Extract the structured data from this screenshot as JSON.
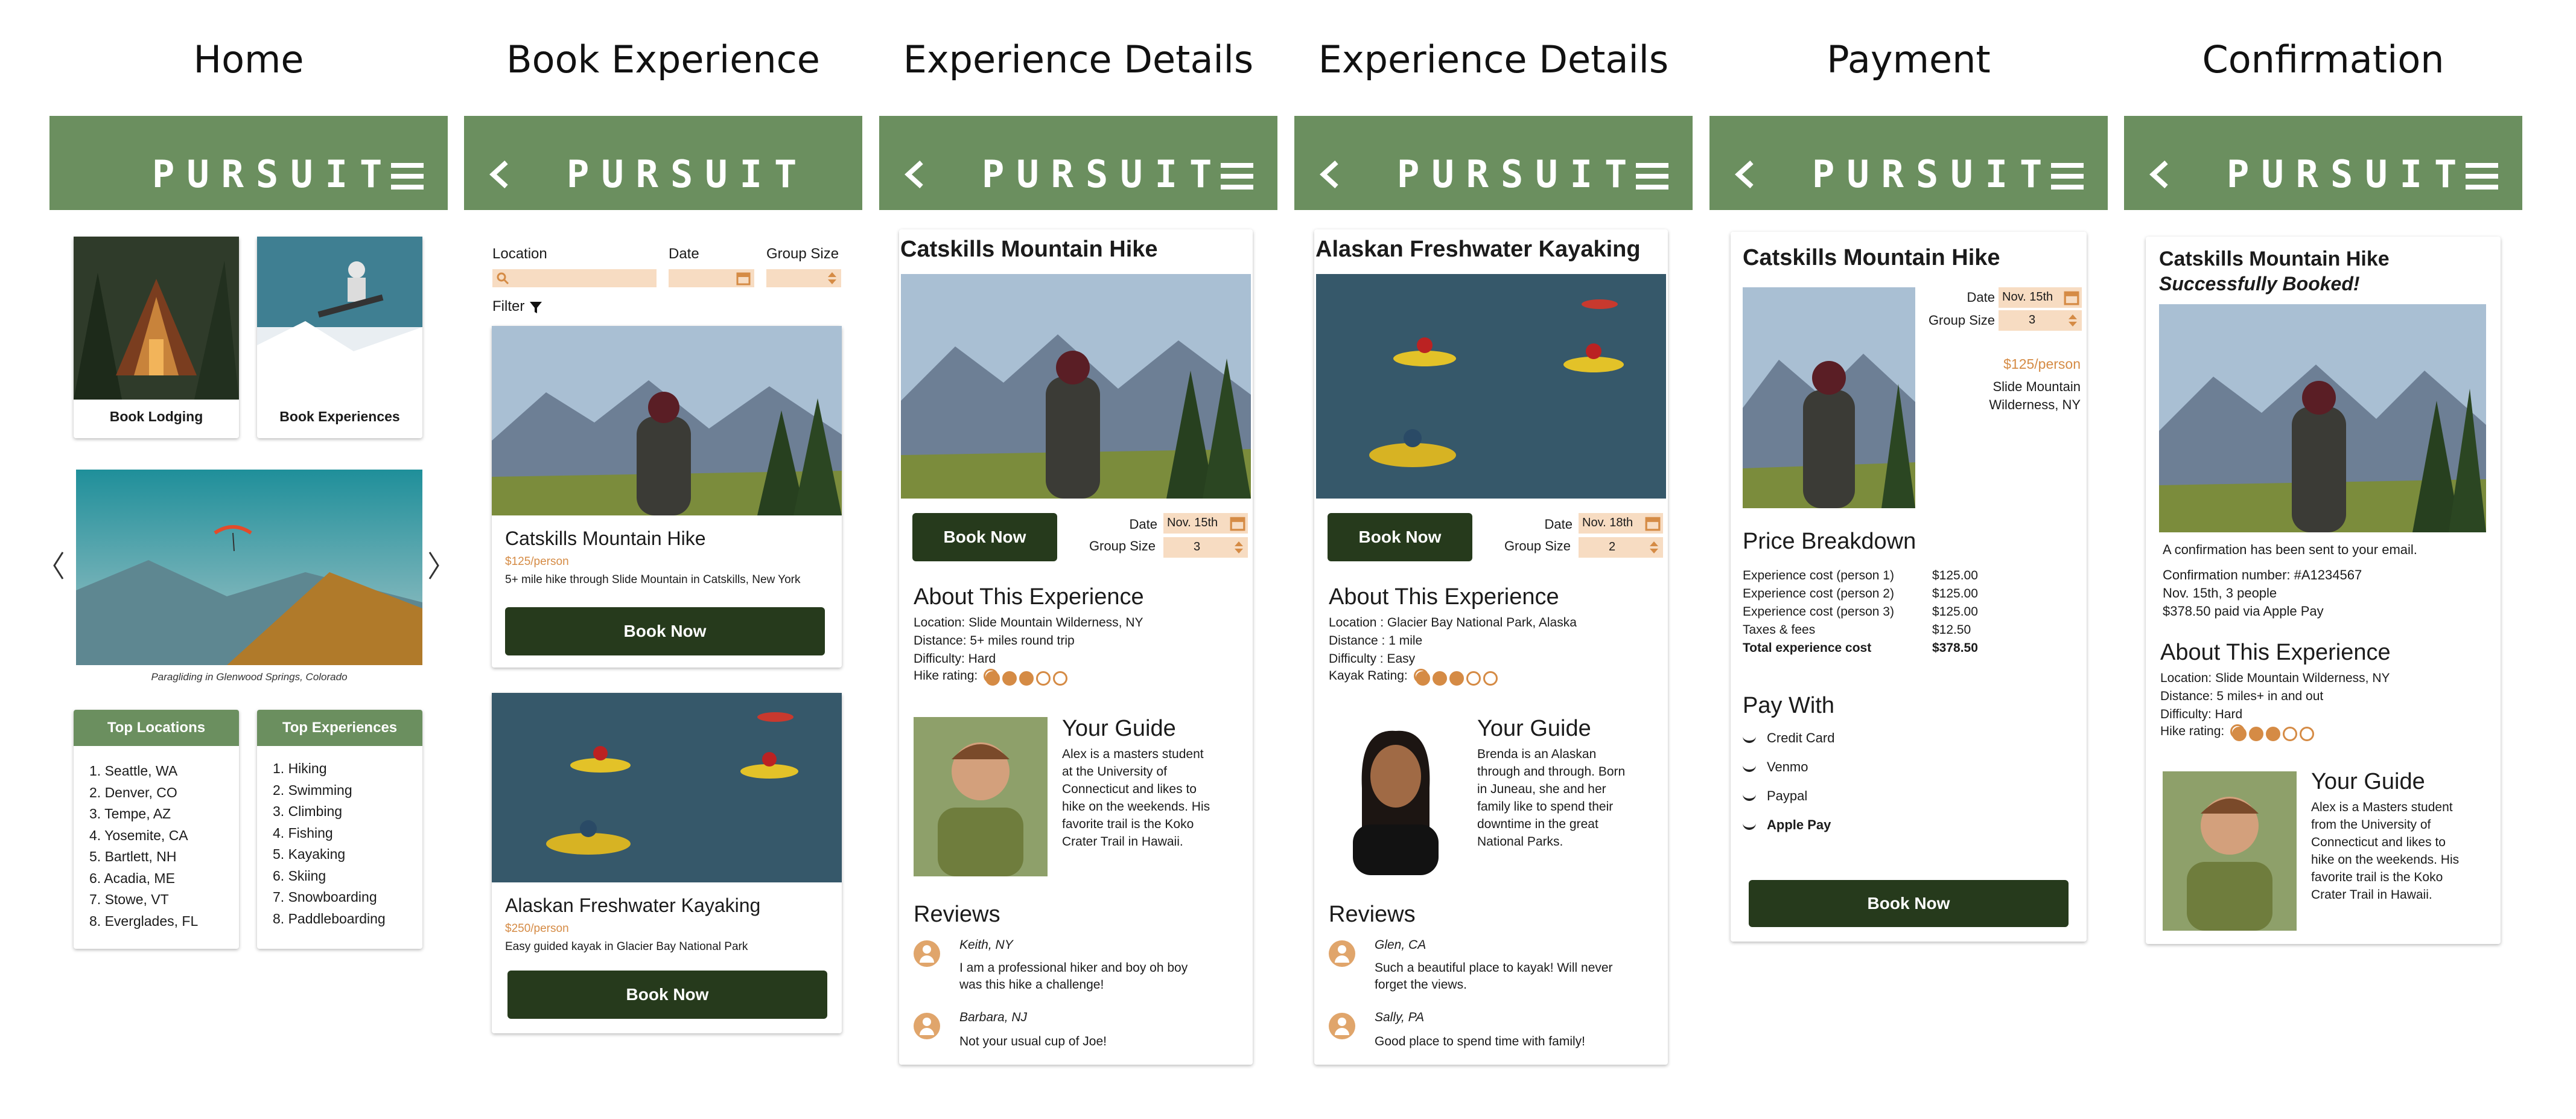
{
  "titles": [
    "Home",
    "Book Experience",
    "Experience Details",
    "Experience Details",
    "Payment",
    "Confirmation"
  ],
  "brand": "PURSUIT",
  "home": {
    "book_lodging": "Book Lodging",
    "book_experiences": "Book Experiences",
    "caption": "Paragliding in Glenwood Springs, Colorado",
    "top_locations_title": "Top Locations",
    "top_locations": [
      "1. Seattle, WA",
      "2. Denver, CO",
      "3. Tempe, AZ",
      "4. Yosemite, CA",
      "5. Bartlett, NH",
      "6. Acadia, ME",
      "7. Stowe, VT",
      "8. Everglades, FL"
    ],
    "top_experiences_title": "Top Experiences",
    "top_experiences": [
      "1. Hiking",
      "2. Swimming",
      "3. Climbing",
      "4. Fishing",
      "5. Kayaking",
      "6. Skiing",
      "7. Snowboarding",
      "8. Paddleboarding"
    ]
  },
  "book": {
    "location_label": "Location",
    "date_label": "Date",
    "group_label": "Group Size",
    "filter_label": "Filter",
    "items": [
      {
        "title": "Catskills Mountain Hike",
        "price": "$125/person",
        "desc": "5+ mile hike through Slide Mountain in Catskills, New York",
        "cta": "Book Now"
      },
      {
        "title": "Alaskan Freshwater Kayaking",
        "price": "$250/person",
        "desc": "Easy guided kayak in Glacier Bay National Park",
        "cta": "Book Now"
      }
    ]
  },
  "details1": {
    "title": "Catskills Mountain Hike",
    "cta": "Book Now",
    "date_label": "Date",
    "date_value": "Nov. 15th",
    "group_label": "Group Size",
    "group_value": "3",
    "about_title": "About This Experience",
    "about_lines": [
      "Location: Slide Mountain Wilderness, NY",
      "Distance: 5+ miles round trip",
      "Difficulty: Hard"
    ],
    "rating_label": "Hike rating:",
    "rating": 3,
    "guide_title": "Your Guide",
    "guide_text": [
      "Alex is a masters student",
      "at the University of",
      "Connecticut and likes to",
      "hike on the weekends. His",
      "favorite trail is the Koko",
      "Crater Trail in Hawaii."
    ],
    "reviews_title": "Reviews",
    "reviews": [
      {
        "name": "Keith, NY",
        "text": [
          "I am a professional hiker and boy oh boy",
          "was this hike a challenge!"
        ]
      },
      {
        "name": "Barbara, NJ",
        "text": [
          "Not your usual cup of Joe!"
        ]
      }
    ]
  },
  "details2": {
    "title": "Alaskan Freshwater Kayaking",
    "cta": "Book Now",
    "date_label": "Date",
    "date_value": "Nov. 18th",
    "group_label": "Group Size",
    "group_value": "2",
    "about_title": "About This Experience",
    "about_lines": [
      "Location : Glacier Bay National Park, Alaska",
      "Distance : 1 mile",
      "Difficulty : Easy"
    ],
    "rating_label": "Kayak Rating:",
    "rating": 3,
    "guide_title": "Your Guide",
    "guide_text": [
      "Brenda is an Alaskan",
      "through and through. Born",
      "in Juneau, she and her",
      "family like to spend their",
      "downtime in the great",
      "National Parks."
    ],
    "reviews_title": "Reviews",
    "reviews": [
      {
        "name": "Glen, CA",
        "text": [
          "Such a beautiful place to kayak! Will never",
          "forget the views."
        ]
      },
      {
        "name": "Sally, PA",
        "text": [
          "Good place to spend time with family!"
        ]
      }
    ]
  },
  "payment": {
    "title": "Catskills Mountain Hike",
    "date_label": "Date",
    "date_value": "Nov. 15th",
    "group_label": "Group Size",
    "group_value": "3",
    "price": "$125/person",
    "location": [
      "Slide Mountain",
      "Wilderness, NY"
    ],
    "breakdown_title": "Price Breakdown",
    "breakdown": [
      {
        "label": "Experience cost (person 1)",
        "value": "$125.00"
      },
      {
        "label": "Experience cost (person 2)",
        "value": "$125.00"
      },
      {
        "label": "Experience cost (person 3)",
        "value": "$125.00"
      },
      {
        "label": "Taxes & fees",
        "value": "$12.50"
      },
      {
        "label": "Total experience cost",
        "value": "$378.50"
      }
    ],
    "pay_title": "Pay With",
    "methods": [
      "Credit Card",
      "Venmo",
      "Paypal",
      "Apple Pay"
    ],
    "cta": "Book Now"
  },
  "confirm": {
    "title": "Catskills Mountain Hike",
    "subtitle": "Successfully Booked!",
    "lines": [
      "A confirmation has been sent to your email.",
      "Confirmation number: #A1234567",
      "Nov. 15th, 3 people",
      "$378.50 paid via Apple Pay"
    ],
    "about_title": "About This Experience",
    "about_lines": [
      "Location: Slide Mountain Wilderness, NY",
      "Distance: 5 miles+ in and out",
      "Difficulty: Hard"
    ],
    "rating_label": "Hike rating:",
    "rating": 3,
    "guide_title": "Your Guide",
    "guide_text": [
      "Alex is a Masters student",
      "from the University of",
      "Connecticut and likes to",
      "hike on the weekends. His",
      "favorite trail is the Koko",
      "Crater Trail in Hawaii."
    ]
  },
  "colors": {
    "header": "#6b8f5f",
    "button": "#263a1c",
    "accent": "#d58b45",
    "field": "#f7dcc2"
  }
}
